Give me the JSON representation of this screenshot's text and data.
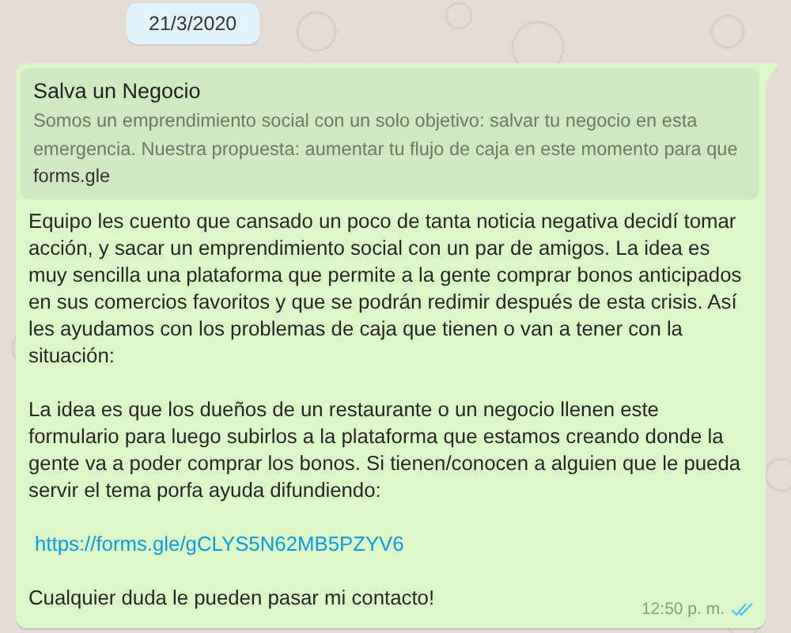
{
  "date_chip": "21/3/2020",
  "message": {
    "link_preview": {
      "title": "Salva un Negocio",
      "description": "Somos un emprendimiento social con un solo objetivo: salvar tu negocio en esta emergencia. Nuestra propuesta: aumentar tu flujo de caja en este momento para que",
      "domain": "forms.gle"
    },
    "paragraphs": [
      {
        "kind": "text",
        "text": "Equipo les cuento que cansado un poco de tanta noticia negativa decidí tomar acción, y sacar un emprendimiento social con un par de amigos. La idea es muy sencilla una plataforma que permite a la gente comprar bonos anticipados en sus comercios favoritos y que se podrán redimir después de esta crisis. Así les ayudamos con los problemas de caja que tienen o van a tener con la situación:"
      },
      {
        "kind": "text",
        "text": "La idea es que los dueños de un restaurante o un negocio llenen este formulario para luego subirlos a la plataforma que estamos creando donde la gente va a poder comprar los bonos. Si tienen/conocen a alguien que le pueda servir el tema porfa ayuda difundiendo:"
      },
      {
        "kind": "link",
        "text": "https://forms.gle/gCLYS5N62MB5PZYV6"
      },
      {
        "kind": "text",
        "text": "Cualquier duda le pueden pasar mi contacto!"
      }
    ],
    "time": "12:50 p. m.",
    "read": true
  }
}
